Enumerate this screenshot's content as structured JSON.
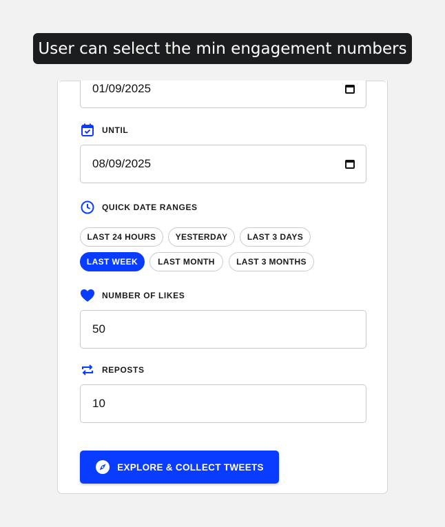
{
  "caption": "User can select the min engagement numbers",
  "form": {
    "since_value": "01/09/2025",
    "until": {
      "label": "UNTIL",
      "value": "08/09/2025",
      "icon": "calendar-check-icon"
    },
    "quick_ranges": {
      "label": "QUICK DATE RANGES",
      "icon": "clock-icon",
      "chips": [
        {
          "label": "LAST 24 HOURS",
          "active": false
        },
        {
          "label": "YESTERDAY",
          "active": false
        },
        {
          "label": "LAST 3 DAYS",
          "active": false
        },
        {
          "label": "LAST WEEK",
          "active": true
        },
        {
          "label": "LAST MONTH",
          "active": false
        },
        {
          "label": "LAST 3 MONTHS",
          "active": false
        }
      ]
    },
    "likes": {
      "label": "NUMBER OF LIKES",
      "value": "50",
      "icon": "heart-icon"
    },
    "reposts": {
      "label": "REPOSTS",
      "value": "10",
      "icon": "repost-icon"
    },
    "submit_label": "EXPLORE & COLLECT TWEETS",
    "submit_icon": "compass-icon"
  },
  "colors": {
    "accent": "#0a3cff",
    "caption_bg": "#1c1d1f",
    "page_bg": "#f2f2f2"
  }
}
